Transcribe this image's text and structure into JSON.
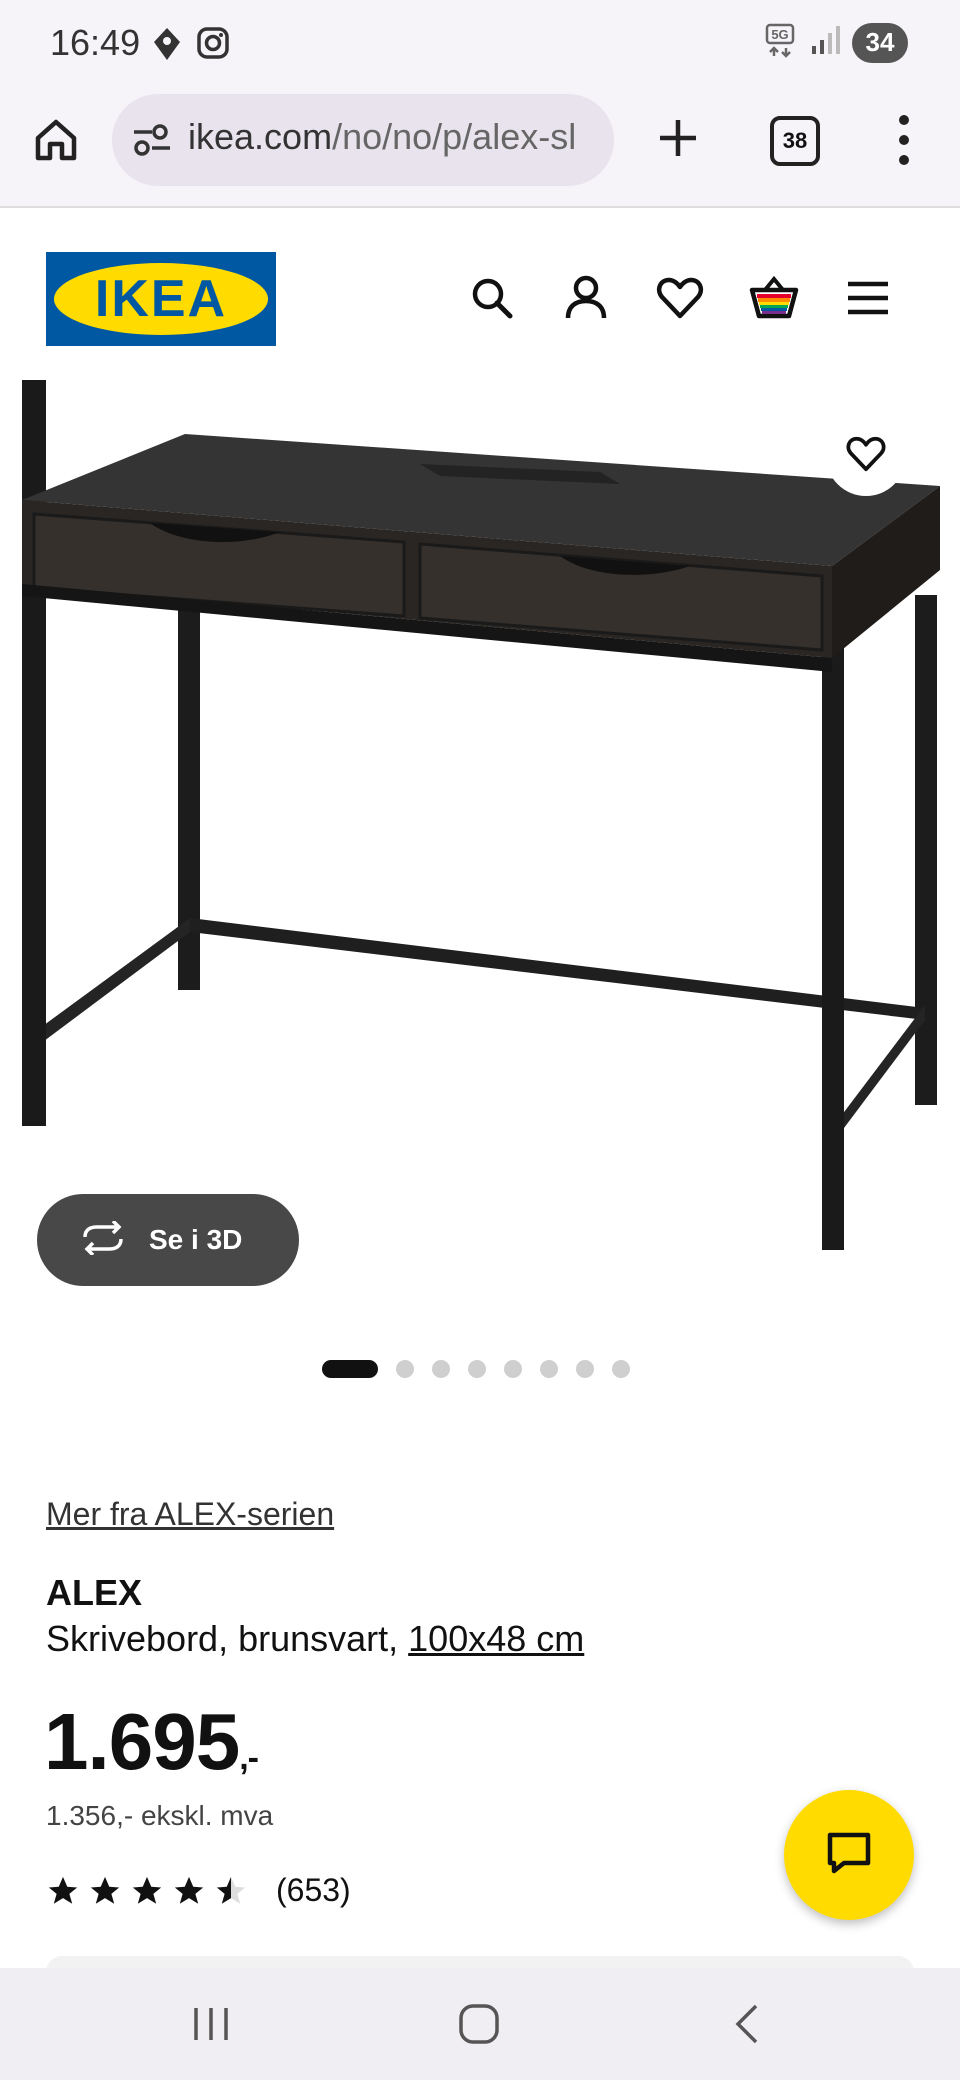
{
  "status_bar": {
    "time": "16:49",
    "network": "5G",
    "battery": "34",
    "icons": [
      "location-icon",
      "instagram-icon",
      "wifi-5g-icon",
      "signal-icon"
    ]
  },
  "browser": {
    "url_host": "ikea.com",
    "url_path": "/no/no/p/alex-sl",
    "tab_count": "38"
  },
  "header": {
    "logo_text": "IKEA",
    "icons": [
      "search-icon",
      "account-icon",
      "wishlist-icon",
      "cart-icon",
      "menu-icon"
    ]
  },
  "gallery": {
    "see_3d_label": "Se i 3D",
    "dot_count": 8,
    "active_index": 0
  },
  "product": {
    "series_link": "Mer fra ALEX-serien",
    "name": "ALEX",
    "description": "Skrivebord, brunsvart, ",
    "size_link": "100x48 cm",
    "price_main": "1.695",
    "price_suffix": ",-",
    "price_ex_vat": "1.356,- ekskl. mva",
    "rating_value": 4.5,
    "review_count": "(653)"
  },
  "colors": {
    "ikea_blue": "#0058a3",
    "ikea_yellow": "#ffdb00",
    "see3d_bg": "#484848"
  }
}
